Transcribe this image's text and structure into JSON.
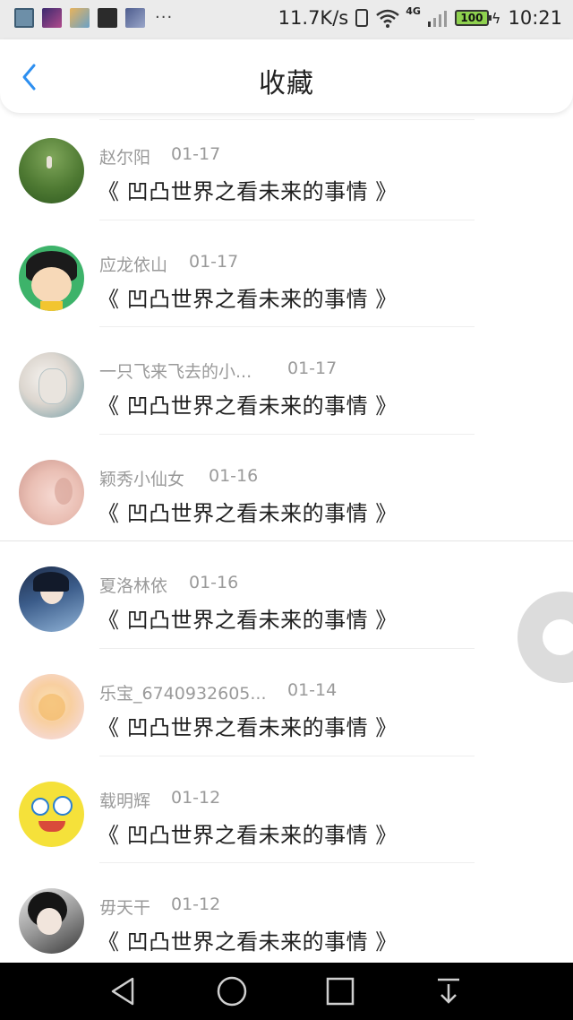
{
  "status_bar": {
    "notification_icons": [
      "image-icon",
      "game-icon",
      "photo-icon",
      "app-icon",
      "news-icon"
    ],
    "more": "···",
    "speed": "11.7K/s",
    "network_type": "4G",
    "battery": "100",
    "time": "10:21"
  },
  "header": {
    "title": "收藏"
  },
  "items": [
    {
      "user": "赵尔阳",
      "date": "01-17",
      "title": "《 凹凸世界之看未来的事情 》"
    },
    {
      "user": "应龙依山",
      "date": "01-17",
      "title": "《 凹凸世界之看未来的事情 》"
    },
    {
      "user": "一只飞来飞去的小...",
      "date": "01-17",
      "title": "《 凹凸世界之看未来的事情 》"
    },
    {
      "user": "颖秀小仙女",
      "date": "01-16",
      "title": "《 凹凸世界之看未来的事情 》"
    },
    {
      "user": "夏洛林依",
      "date": "01-16",
      "title": "《 凹凸世界之看未来的事情 》"
    },
    {
      "user": "乐宝_6740932605...",
      "date": "01-14",
      "title": "《 凹凸世界之看未来的事情 》"
    },
    {
      "user": "载明辉",
      "date": "01-12",
      "title": "《 凹凸世界之看未来的事情 》"
    },
    {
      "user": "毋天干",
      "date": "01-12",
      "title": "《 凹凸世界之看未来的事情 》"
    }
  ],
  "colors": {
    "accent": "#2d8ff0",
    "status_bar_bg": "#ebebeb",
    "nav_bar_bg": "#000000"
  }
}
